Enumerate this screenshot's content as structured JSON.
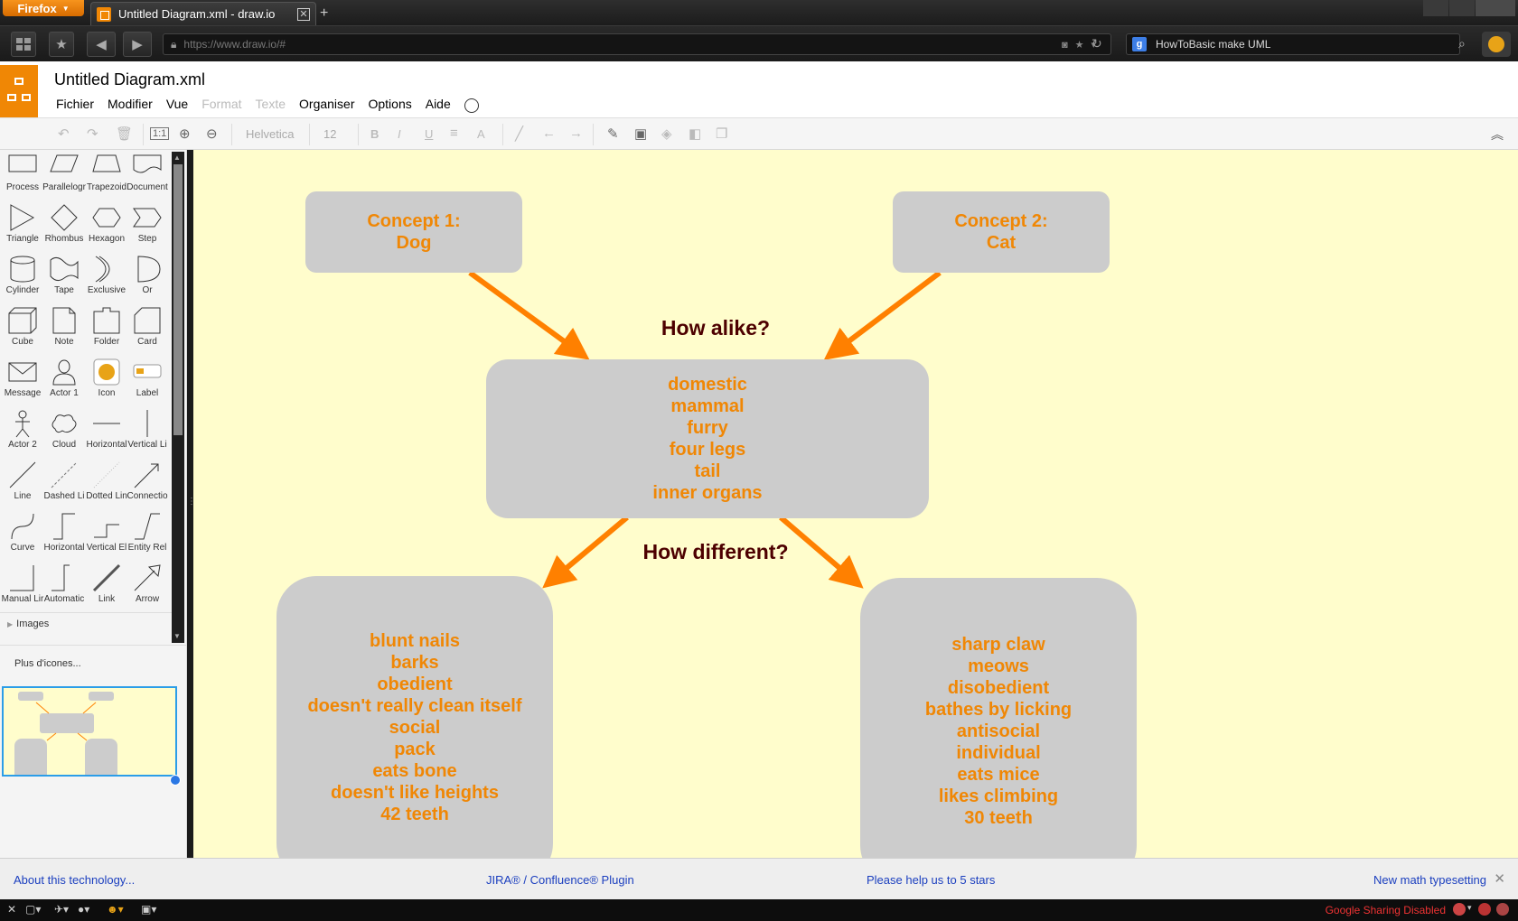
{
  "browser": {
    "menu_button": "Firefox",
    "tab_title": "Untitled Diagram.xml - draw.io",
    "tab_close": "✕",
    "new_tab": "+",
    "url": "https://www.draw.io/#",
    "search_engine_letter": "g",
    "search_query": "HowToBasic make UML"
  },
  "app": {
    "document_title": "Untitled Diagram.xml",
    "menu": {
      "file": "Fichier",
      "edit": "Modifier",
      "view": "Vue",
      "format": "Format",
      "text": "Texte",
      "arrange": "Organiser",
      "options": "Options",
      "help": "Aide"
    },
    "toolbar": {
      "font_family": "Helvetica",
      "font_size": "12",
      "bold": "B",
      "italic": "I",
      "underline": "U",
      "font_color": "A"
    }
  },
  "sidebar": {
    "shapes": [
      "Process",
      "Parallelogr",
      "Trapezoid",
      "Document",
      "Triangle",
      "Rhombus",
      "Hexagon",
      "Step",
      "Cylinder",
      "Tape",
      "Exclusive",
      "Or",
      "Cube",
      "Note",
      "Folder",
      "Card",
      "Message",
      "Actor 1",
      "Icon",
      "Label",
      "Actor 2",
      "Cloud",
      "Horizontal",
      "Vertical Li",
      "Line",
      "Dashed Li",
      "Dotted Lin",
      "Connectio",
      "Curve",
      "Horizontal",
      "Vertical El",
      "Entity Rel",
      "Manual Lir",
      "Automatic",
      "Link",
      "Arrow"
    ],
    "images_section": "Images",
    "more_icons": "Plus d'icones..."
  },
  "diagram": {
    "concept1": [
      "Concept 1:",
      "Dog"
    ],
    "concept2": [
      "Concept 2:",
      "Cat"
    ],
    "alike_question": "How alike?",
    "different_question": "How different?",
    "similarities": [
      "domestic",
      "mammal",
      "furry",
      "four legs",
      "tail",
      "inner organs"
    ],
    "dog_traits": [
      "blunt nails",
      "barks",
      "obedient",
      "doesn't really clean itself",
      "social",
      "pack",
      "eats bone",
      "doesn't like heights",
      "42 teeth"
    ],
    "cat_traits": [
      "sharp claw",
      "meows",
      "disobedient",
      "bathes by licking",
      "antisocial",
      "individual",
      "eats mice",
      "likes climbing",
      "30 teeth"
    ],
    "colors": {
      "canvas": "#fffdcc",
      "box": "#cccccc",
      "text": "#f08705",
      "question": "#4d0000",
      "arrow": "#ff8000"
    }
  },
  "footer": {
    "about": "About this technology...",
    "plugin": "JIRA® / Confluence® Plugin",
    "rate": "Please help us to 5 stars",
    "math": "New math typesetting",
    "close": "✕"
  },
  "addon_bar": {
    "google_sharing": "Google Sharing Disabled"
  }
}
